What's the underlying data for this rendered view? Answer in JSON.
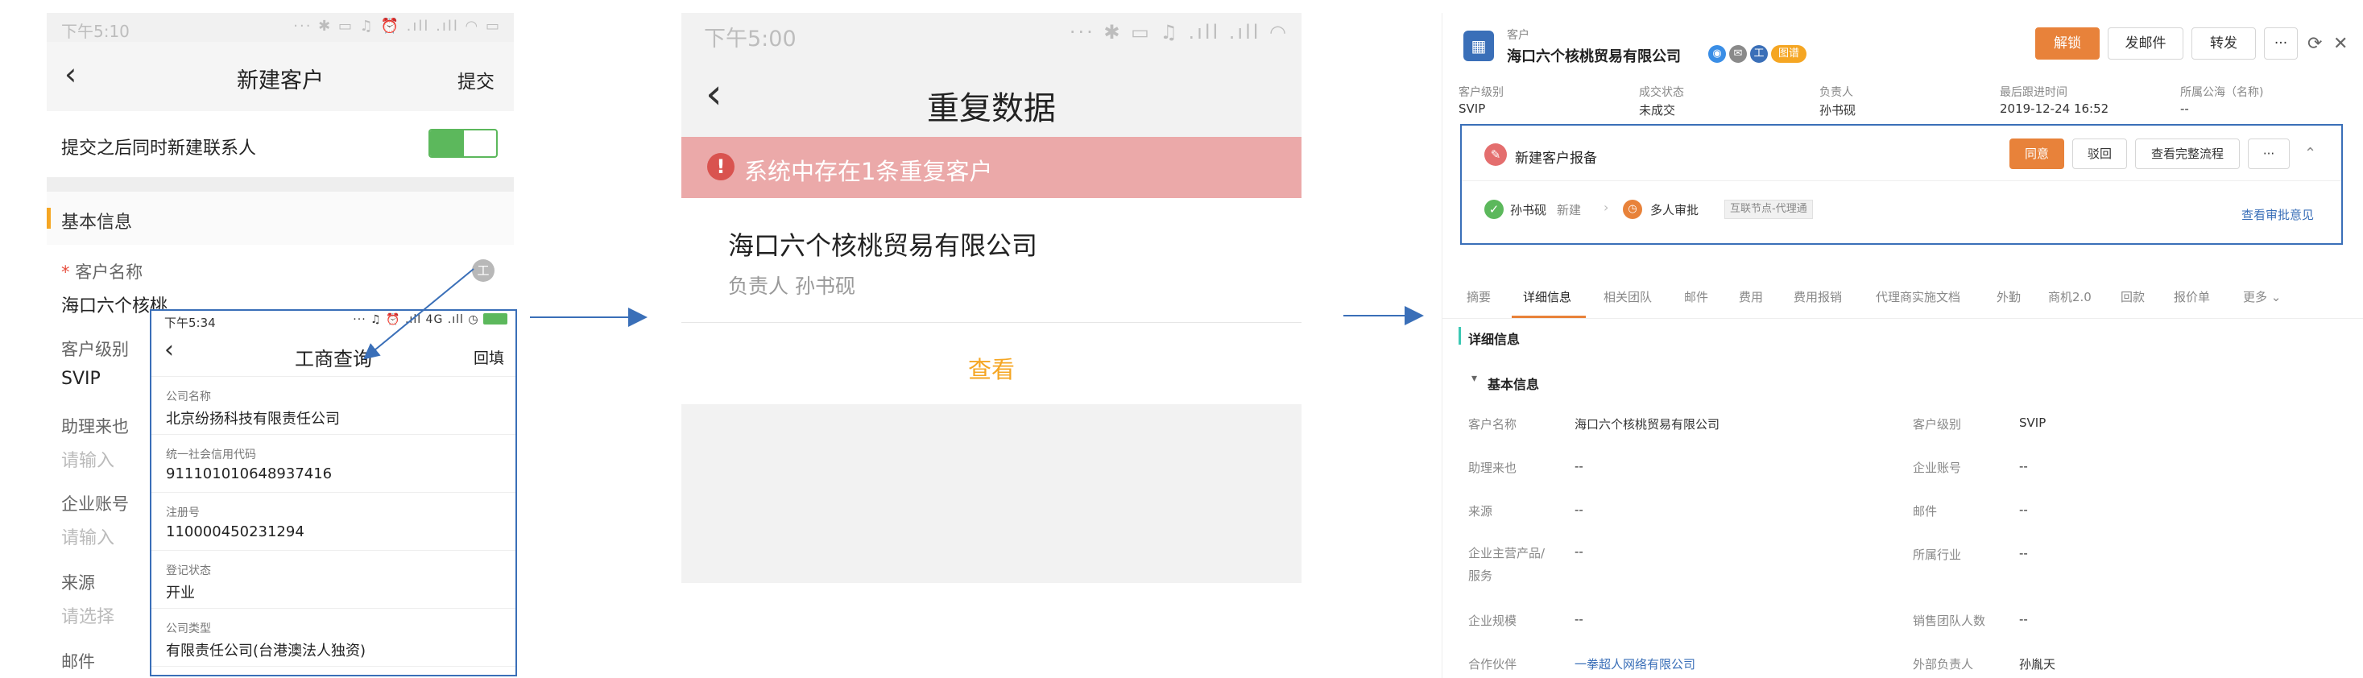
{
  "flow": {
    "arrow_color": "#3a6fb8"
  },
  "mobile_create": {
    "status_time": "下午5:10",
    "status_icons": "··· ✱ ▭ ♫ ⏰ .ıll .ıll ◠ ▭",
    "nav": {
      "back": "‹",
      "title": "新建客户",
      "submit": "提交"
    },
    "toggle_label": "提交之后同时新建联系人",
    "toggle_on": true,
    "section_title": "基本信息",
    "fields": [
      {
        "label": "客户名称",
        "required_mark": "*",
        "value": "海口六个核桃"
      },
      {
        "label": "客户级别",
        "value": "SVIP"
      },
      {
        "label": "助理来也",
        "placeholder": "请输入"
      },
      {
        "label": "企业账号",
        "placeholder": "请输入"
      },
      {
        "label": "来源",
        "placeholder": "请选择"
      },
      {
        "label": "邮件"
      }
    ],
    "clear_icon": "工",
    "popup": {
      "status_time": "下午5:34",
      "status_icons": "··· ♫ ⏰ .ıll 4G .ıll ◷",
      "nav": {
        "back": "‹",
        "title": "工商查询",
        "fill": "回填"
      },
      "rows": [
        {
          "label": "公司名称",
          "value": "北京纷扬科技有限责任公司"
        },
        {
          "label": "统一社会信用代码",
          "value": "911101010648937416"
        },
        {
          "label": "注册号",
          "value": "110000450231294"
        },
        {
          "label": "登记状态",
          "value": "开业"
        },
        {
          "label": "公司类型",
          "value": "有限责任公司(台港澳法人独资)"
        }
      ]
    }
  },
  "mobile_duplicate": {
    "status_time": "下午5:00",
    "status_icons": "··· ✱ ▭ ♫ .ıll .ıll ◠",
    "nav": {
      "back": "‹",
      "title": "重复数据"
    },
    "alert": {
      "icon": "!",
      "text": "系统中存在1条重复客户"
    },
    "card": {
      "name": "海口六个核桃贸易有限公司",
      "owner": "负责人 孙书砚",
      "view": "查看"
    }
  },
  "desktop_detail": {
    "header": {
      "icon": "▦",
      "type": "客户",
      "name": "海口六个核桃贸易有限公司",
      "badges": [
        {
          "text": "◉",
          "color": "#3a8ee6"
        },
        {
          "text": "✉",
          "color": "#8a8a8a"
        },
        {
          "text": "工",
          "color": "#3a6fb8"
        },
        {
          "text": "图谱",
          "color": "#f5a623"
        }
      ],
      "buttons": {
        "unlock": "解锁",
        "mail": "发邮件",
        "transfer": "转发",
        "more": "···"
      },
      "refresh_icon": "⟳",
      "close_icon": "✕"
    },
    "summary": [
      {
        "label": "客户级别",
        "value": "SVIP"
      },
      {
        "label": "成交状态",
        "value": "未成交"
      },
      {
        "label": "负责人",
        "value": "孙书砚"
      },
      {
        "label": "最后跟进时间",
        "value": "2019-12-24 16:52"
      },
      {
        "label": "所属公海（名称)",
        "value": "--"
      }
    ],
    "approval": {
      "icon": "✎",
      "title": "新建客户报备",
      "buttons": {
        "agree": "同意",
        "reject": "驳回",
        "view_flow": "查看完整流程",
        "more": "···",
        "collapse": "⌃"
      },
      "step1_icon": "✓",
      "step1_name": "孙书砚",
      "step1_action": "新建",
      "arrow": "›",
      "step2_icon": "◷",
      "step2_name": "多人审批",
      "step2_tag": "互联节点-代理通",
      "view_opinion": "查看审批意见"
    },
    "tabs": [
      "摘要",
      "详细信息",
      "相关团队",
      "邮件",
      "费用",
      "费用报销",
      "代理商实施文档",
      "外勤",
      "商机2.0",
      "回款",
      "报价单",
      "更多 ⌄"
    ],
    "active_tab": 1,
    "detail_title": "详细信息",
    "basic_title": "基本信息",
    "caret": "▾",
    "left_fields": [
      {
        "label": "客户名称",
        "value": "海口六个核桃贸易有限公司"
      },
      {
        "label": "助理来也",
        "value": "--"
      },
      {
        "label": "来源",
        "value": "--"
      },
      {
        "label": "企业主营产品/",
        "label2": "服务",
        "value": "--"
      },
      {
        "label": "企业规模",
        "value": "--"
      },
      {
        "label": "合作伙伴",
        "value": "一拳超人网络有限公司",
        "link": true
      }
    ],
    "right_fields": [
      {
        "label": "客户级别",
        "value": "SVIP"
      },
      {
        "label": "企业账号",
        "value": "--"
      },
      {
        "label": "邮件",
        "value": "--"
      },
      {
        "label": "所属行业",
        "value": "--"
      },
      {
        "label": "销售团队人数",
        "value": "--"
      },
      {
        "label": "外部负责人",
        "value": "孙胤天"
      }
    ]
  }
}
